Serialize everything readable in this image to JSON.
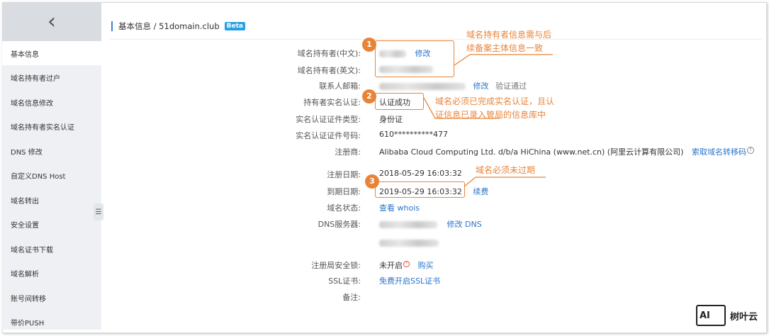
{
  "sidebar": {
    "back_icon": "chevron-left-icon",
    "items": [
      {
        "label": "基本信息",
        "active": true
      },
      {
        "label": "域名持有者过户"
      },
      {
        "label": "域名信息修改"
      },
      {
        "label": "域名持有者实名认证"
      },
      {
        "label": "DNS 修改"
      },
      {
        "label": "自定义DNS Host"
      },
      {
        "label": "域名转出"
      },
      {
        "label": "安全设置"
      },
      {
        "label": "域名证书下载"
      },
      {
        "label": "域名解析"
      },
      {
        "label": "账号间转移"
      },
      {
        "label": "带价PUSH"
      }
    ],
    "collapse_icon": "collapse-sidebar-icon"
  },
  "header": {
    "breadcrumb": "基本信息 / 51domain.club",
    "badge": "Beta"
  },
  "fields": {
    "owner_cn_label": "域名持有者(中文):",
    "owner_cn_edit": "修改",
    "owner_en_label": "域名持有者(英文):",
    "email_label": "联系人邮箱:",
    "email_edit": "修改",
    "email_status": "验证通过",
    "realname_label": "持有者实名认证:",
    "realname_value": "认证成功",
    "cert_type_label": "实名认证证件类型:",
    "cert_type_value": "身份证",
    "cert_no_label": "实名认证证件号码:",
    "cert_no_value": "610**********477",
    "registrar_label": "注册商:",
    "registrar_value": "Alibaba Cloud Computing Ltd. d/b/a HiChina (www.net.cn) (阿里云计算有限公司)",
    "transfer_code_link": "索取域名转移码",
    "reg_date_label": "注册日期:",
    "reg_date_value": "2018-05-29 16:03:32",
    "exp_date_label": "到期日期:",
    "exp_date_value": "2019-05-29 16:03:32",
    "renew_link": "续费",
    "status_label": "域名状态:",
    "status_link": "查看 whois",
    "dns_label": "DNS服务器:",
    "dns_edit": "修改 DNS",
    "lock_label": "注册局安全锁:",
    "lock_value": "未开启",
    "lock_buy": "购买",
    "ssl_label": "SSL证书:",
    "ssl_link": "免费开启SSL证书",
    "remark_label": "备注:"
  },
  "annotations": [
    {
      "number": "1",
      "text": [
        "域名持有者信息需与后",
        "续备案主体信息一致"
      ]
    },
    {
      "number": "2",
      "text": [
        "域名必须已完成实名认证，且认",
        "证信息已录入管局的信息库中"
      ]
    },
    {
      "number": "3",
      "text": [
        "域名必须未过期"
      ]
    }
  ],
  "watermark": {
    "mark": "AI",
    "text": "树叶云"
  },
  "colors": {
    "accent": "#e8843a",
    "link": "#2b74c9",
    "beta": "#2aa0e4",
    "sidebar_bg": "#eef0f3"
  }
}
